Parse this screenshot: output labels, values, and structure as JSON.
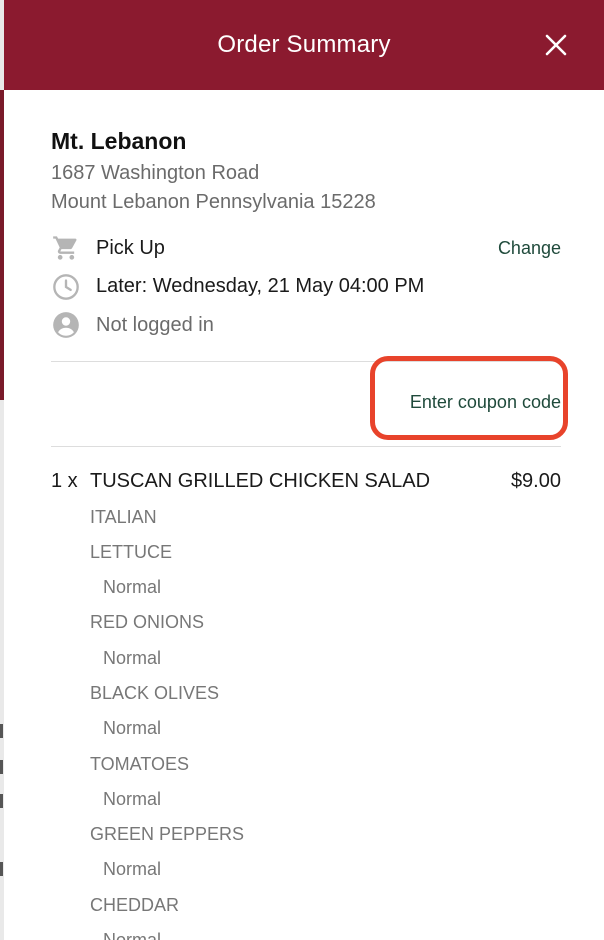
{
  "header": {
    "title": "Order Summary",
    "close_icon": "close-icon"
  },
  "store": {
    "name": "Mt. Lebanon",
    "address_line1": "1687 Washington Road",
    "address_line2": "Mount Lebanon Pennsylvania 15228"
  },
  "info": {
    "order_type": "Pick Up",
    "order_type_icon": "cart-icon",
    "change_label": "Change",
    "time": "Later: Wednesday, 21 May 04:00 PM",
    "time_icon": "clock-icon",
    "login_status": "Not logged in",
    "login_icon": "user-icon"
  },
  "coupon": {
    "label": "Enter coupon code",
    "highlight_color": "#e8432b"
  },
  "order": {
    "items": [
      {
        "qty": "1 x",
        "name": "TUSCAN GRILLED CHICKEN SALAD",
        "price": "$9.00",
        "modifiers": [
          {
            "group": "ITALIAN",
            "option": ""
          },
          {
            "group": "LETTUCE",
            "option": "Normal"
          },
          {
            "group": "RED ONIONS",
            "option": "Normal"
          },
          {
            "group": "BLACK OLIVES",
            "option": "Normal"
          },
          {
            "group": "TOMATOES",
            "option": "Normal"
          },
          {
            "group": "GREEN PEPPERS",
            "option": "Normal"
          },
          {
            "group": "CHEDDAR",
            "option": "Normal"
          }
        ]
      }
    ]
  },
  "colors": {
    "header_bg": "#8b1a2f",
    "link": "#1f4a3b",
    "muted_text": "#6b6b6b"
  }
}
